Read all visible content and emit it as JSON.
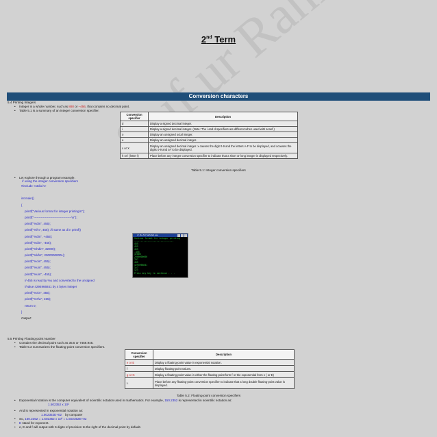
{
  "page": {
    "title_main": "2",
    "title_sup": "nd",
    "title_rest": " Term",
    "watermark": "Saif ur Rahman"
  },
  "banner": "Conversion characters",
  "s1": {
    "heading": "5.4 Printing Integers",
    "b1a": "Integer is a whole number, such as ",
    "b1v1": "880",
    "b1b": " or ",
    "b1v2": "–456",
    "b1c": ", that contains no decimal point.",
    "b2": "Table 5.1 is a summary of an integer conversion specifier."
  },
  "table1": {
    "h1": "Conversion specifier",
    "h2": "Description",
    "rows": [
      {
        "spec": "d",
        "desc": "Display a signed decimal integer."
      },
      {
        "spec": "i",
        "desc": "Display a signed decimal integer. (Note: The i and d specifiers are different when used with scanf.)"
      },
      {
        "spec": "o",
        "desc": "Display an unsigned octal integer."
      },
      {
        "spec": "u",
        "desc": "Display an unsigned decimal integer."
      },
      {
        "spec": "x or X",
        "desc": "Display an unsigned decimal integer. x causes the digit 0-9 and the letters A-F to be displayed, and xcauses the digits 0-9 and a-f to be displayed."
      },
      {
        "spec": "h or l (letter l)",
        "desc": "Place before any integer conversion specifier to indicate that a short or long integer is displayed respectively."
      }
    ],
    "caption": "Table 5.1: Integer conversion specifiers"
  },
  "s2": {
    "bullet": "Let explore through a program example.",
    "comment": "// using the integer conversion specifiers",
    "code": [
      "#include <stdio.h>",
      "",
      "int main()",
      "{",
      "printf(\"Various format for integer printing\\n\");",
      "printf(\"-------------------------------------\\n\");",
      "printf(\"%d\\n\", 455);",
      "printf(\"%i\\n\", 455); //i same as d in printf()",
      "printf(\"%d\\n\", +455);",
      "printf(\"%d\\n\", -455);",
      "printf(\"%hd\\n\", 32000);",
      "printf(\"%ld\\n\", 2000000000L);",
      "printf(\"%o\\n\", 455);",
      "printf(\"%u\\n\", 455);",
      "printf(\"%u\\n\", -455);",
      "//-455 is read by %u and converted to the unsigned",
      "//value 4294966841 by 4 bytes integer",
      "printf(\"%x\\n\", 455);",
      "printf(\"%X\\n\", 455);",
      "return 0;",
      "}"
    ],
    "output_label": "Output:"
  },
  "terminal": {
    "title": "c:\\ Do-Tet Saifullah.exe",
    "lines": "Various format for integer printing\n------------------------------\n455\n455\n455\n-455\n32000\n2000000000\n707\n455\n4294966841\n1c7\n1C7\nPress any key to continue . . ."
  },
  "s3": {
    "heading": "5.5 Printing Floating-point Number",
    "b1": "Contains the decimal point such as 35.5 or 7456.945.",
    "b2": "Table 5.2 summarizes the floating-point conversion specifiers."
  },
  "table2": {
    "h1": "Conversion specifier",
    "h2": "Description",
    "rows": [
      {
        "spec": "e or E",
        "desc": "Display a floating-point value in exponential notation."
      },
      {
        "spec": "f",
        "desc": "Display floating-point values."
      },
      {
        "spec": "g or G",
        "desc": "Display a floating-point value in either the floating-point form f or the exponential form e ( or E)"
      },
      {
        "spec": "L",
        "desc": "Place before any floating-point conversion specifier to indicate that a long double floating-point value is displayed."
      }
    ],
    "caption": "Table 5.2: Floating-point conversion specifiers"
  },
  "s4": {
    "b1a": "Exponential notation is the computer equivalent of scientific notation used in mathematics. For example, ",
    "b1v": "150.2352",
    "b1b": " is represented in scientific notation as:",
    "sci": "1.502352 x 10²",
    "b2": "And is represented in exponential notation as:",
    "exp": "1.502352E+02",
    "exp_note": "by computer",
    "b3a": "So, ",
    "b3v": "150.2352 = 1.502352 x 10² = 1.502352E+02",
    "b4a": "E",
    "b4b": " stand for exponent.",
    "b5": "e, E and f will output with 6 digits of precision to the right of the decimal point by default."
  }
}
